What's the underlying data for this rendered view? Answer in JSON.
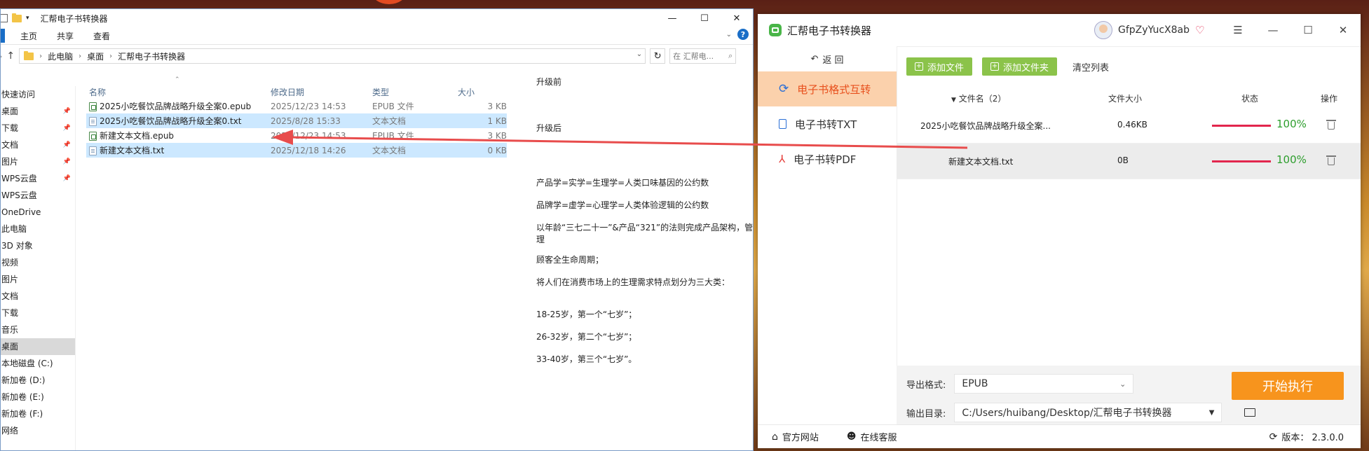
{
  "explorer": {
    "title": "汇帮电子书转换器",
    "ribbon_tabs": [
      "主页",
      "共享",
      "查看"
    ],
    "breadcrumb": [
      "此电脑",
      "桌面",
      "汇帮电子书转换器"
    ],
    "search_placeholder": "在 汇帮电...",
    "nav_items": [
      {
        "label": "快速访问",
        "pinned": false
      },
      {
        "label": "桌面",
        "pinned": true
      },
      {
        "label": "下载",
        "pinned": true
      },
      {
        "label": "文档",
        "pinned": true
      },
      {
        "label": "图片",
        "pinned": true
      },
      {
        "label": "WPS云盘",
        "pinned": true
      },
      {
        "label": "WPS云盘",
        "pinned": false
      },
      {
        "label": "OneDrive",
        "pinned": false
      },
      {
        "label": "此电脑",
        "pinned": false
      },
      {
        "label": "3D 对象",
        "pinned": false
      },
      {
        "label": "视频",
        "pinned": false
      },
      {
        "label": "图片",
        "pinned": false
      },
      {
        "label": "文档",
        "pinned": false
      },
      {
        "label": "下载",
        "pinned": false
      },
      {
        "label": "音乐",
        "pinned": false
      },
      {
        "label": "桌面",
        "pinned": false,
        "selected": true
      },
      {
        "label": "本地磁盘 (C:)",
        "pinned": false
      },
      {
        "label": "新加卷 (D:)",
        "pinned": false
      },
      {
        "label": "新加卷 (E:)",
        "pinned": false
      },
      {
        "label": "新加卷 (F:)",
        "pinned": false
      },
      {
        "label": "网络",
        "pinned": false
      }
    ],
    "columns": {
      "name": "名称",
      "date": "修改日期",
      "type": "类型",
      "size": "大小"
    },
    "files": [
      {
        "name": "2025小吃餐饮品牌战略升级全案0.epub",
        "date": "2025/12/23 14:53",
        "type": "EPUB 文件",
        "size": "3 KB",
        "icon": "epub",
        "selected": false
      },
      {
        "name": "2025小吃餐饮品牌战略升级全案0.txt",
        "date": "2025/8/28 15:33",
        "type": "文本文档",
        "size": "1 KB",
        "icon": "txt",
        "selected": true
      },
      {
        "name": "新建文本文档.epub",
        "date": "2025/12/23 14:53",
        "type": "EPUB 文件",
        "size": "3 KB",
        "icon": "epub",
        "selected": false
      },
      {
        "name": "新建文本文档.txt",
        "date": "2025/12/18 14:26",
        "type": "文本文档",
        "size": "0 KB",
        "icon": "txt",
        "selected": true
      }
    ],
    "preview_lines": [
      "升级前",
      "升级后",
      "产品学=实学=生理学=人类口味基因的公约数",
      "品牌学=虚学=心理学=人类体验逻辑的公约数",
      "以年龄“三七二十一”&产品“321”的法则完成产品架构，管理",
      "顾客全生命周期；",
      "将人们在消费市场上的生理需求特点划分为三大类：",
      "18-25岁，第一个“七岁”；",
      "26-32岁，第二个“七岁”；",
      "33-40岁，第三个“七岁”。"
    ]
  },
  "app": {
    "title": "汇帮电子书转换器",
    "username": "GfpZyYucX8ab",
    "back_label": "返 回",
    "sidebar": [
      {
        "label": "电子书格式互转",
        "active": true,
        "icon": "refresh-icon"
      },
      {
        "label": "电子书转TXT",
        "active": false,
        "icon": "document-icon"
      },
      {
        "label": "电子书转PDF",
        "active": false,
        "icon": "pdf-icon"
      }
    ],
    "toolbar": {
      "add_file": "添加文件",
      "add_folder": "添加文件夹",
      "clear_list": "清空列表"
    },
    "table_head": {
      "name": "文件名（2）",
      "size": "文件大小",
      "status": "状态",
      "action": "操作"
    },
    "rows": [
      {
        "name": "2025小吃餐饮品牌战略升级全案...",
        "size": "0.46KB",
        "progress": 100,
        "pct": "100%"
      },
      {
        "name": "新建文本文档.txt",
        "size": "0B",
        "progress": 100,
        "pct": "100%"
      }
    ],
    "export_label": "导出格式:",
    "export_value": "EPUB",
    "output_label": "输出目录:",
    "output_value": "C:/Users/huibang/Desktop/汇帮电子书转换器",
    "start_label": "开始执行",
    "footer": {
      "website": "官方网站",
      "service": "在线客服",
      "version": "版本： 2.3.0.0"
    },
    "colors": {
      "accent": "#f7941d",
      "green": "#8bc34a",
      "active_bg": "#fbd1ac",
      "progress": "#e2264d"
    }
  }
}
